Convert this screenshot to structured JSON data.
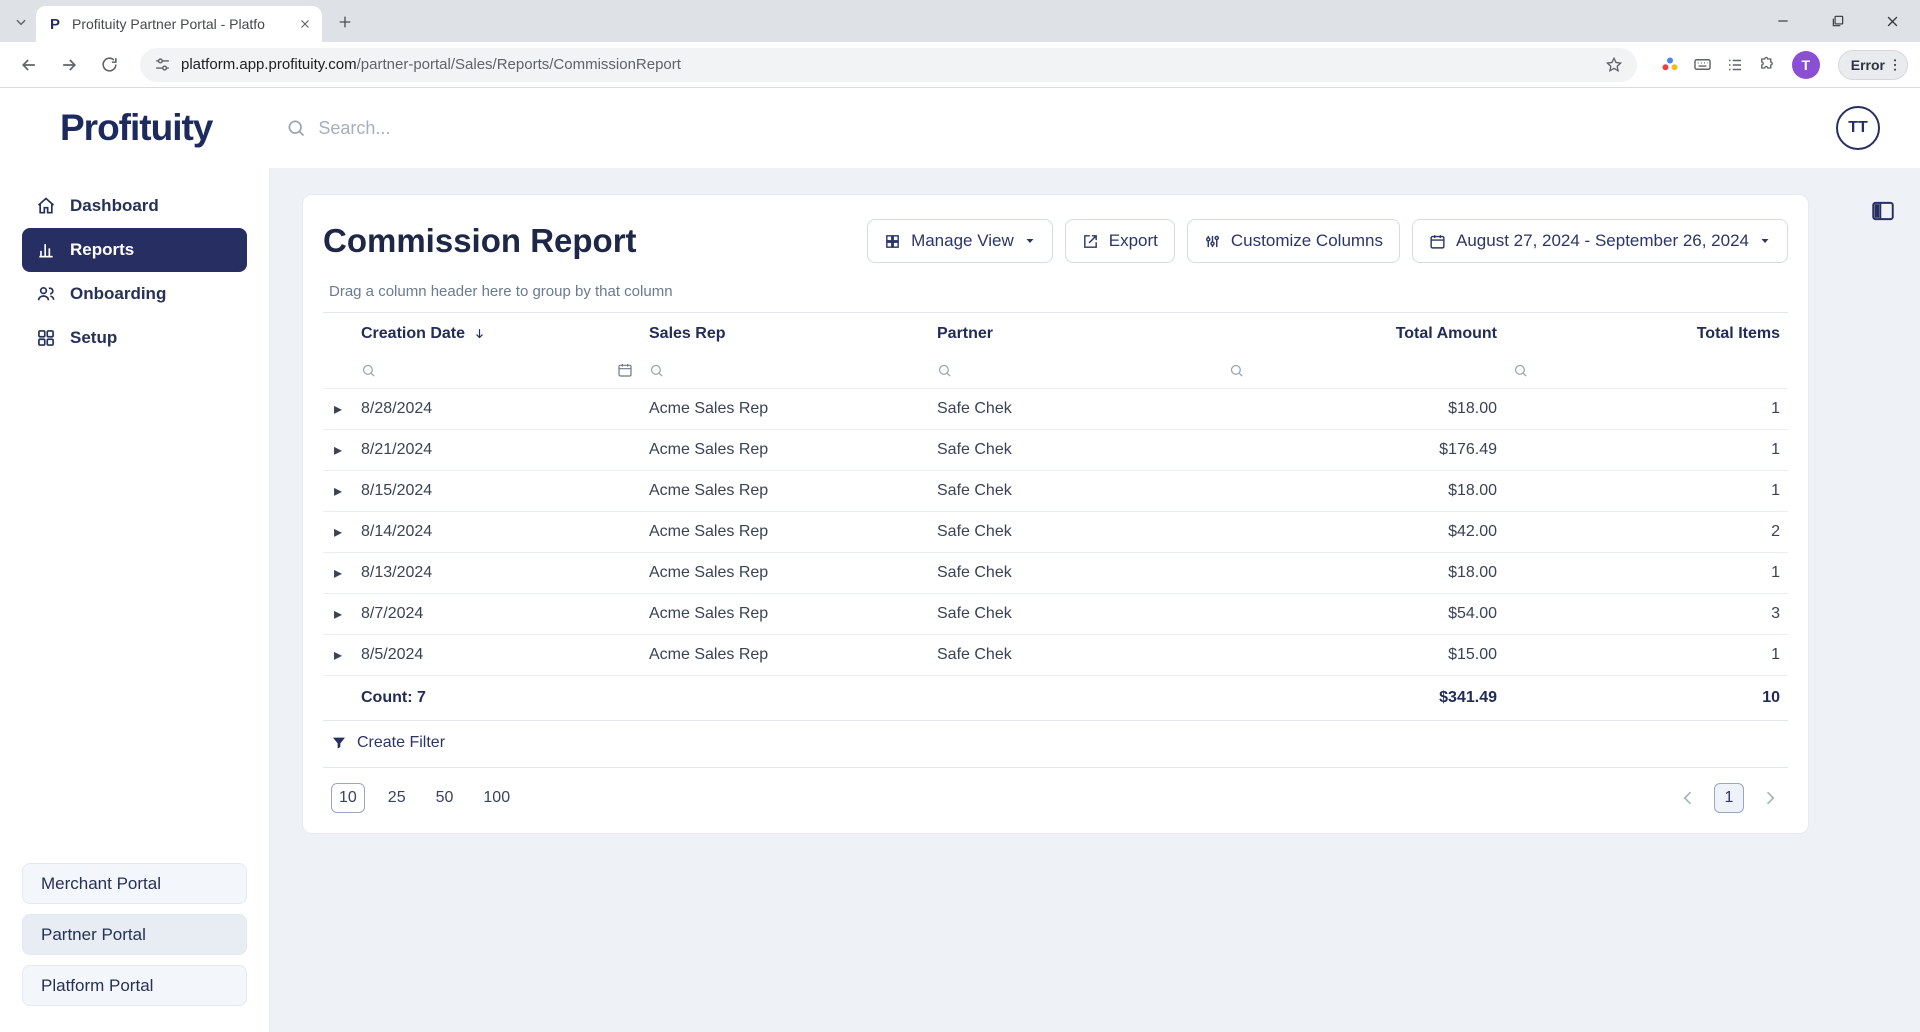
{
  "browser": {
    "tab": {
      "title": "Profituity Partner Portal - Platfo",
      "favicon_letter": "P"
    },
    "url": {
      "domain": "platform.app.profituity.com",
      "path": "/partner-portal/Sales/Reports/CommissionReport"
    },
    "error_label": "Error",
    "profile_initial": "T"
  },
  "app_header": {
    "logo": "Profituity",
    "search_placeholder": "Search...",
    "avatar_initials": "TT"
  },
  "sidebar": {
    "items": [
      {
        "label": "Dashboard",
        "icon": "home-icon"
      },
      {
        "label": "Reports",
        "icon": "bar-chart-icon"
      },
      {
        "label": "Onboarding",
        "icon": "users-icon"
      },
      {
        "label": "Setup",
        "icon": "widgets-icon"
      }
    ],
    "portal_buttons": [
      {
        "label": "Merchant Portal"
      },
      {
        "label": "Partner Portal"
      },
      {
        "label": "Platform Portal"
      }
    ]
  },
  "main": {
    "title": "Commission Report",
    "toolbar": {
      "manage_view_label": "Manage View",
      "export_label": "Export",
      "customize_columns_label": "Customize Columns",
      "date_range_label": "August 27, 2024 - September 26, 2024"
    },
    "group_hint": "Drag a column header here to group by that column",
    "table": {
      "columns": [
        "Creation Date",
        "Sales Rep",
        "Partner",
        "Total Amount",
        "Total Items"
      ],
      "rows": [
        {
          "creation_date": "8/28/2024",
          "sales_rep": "Acme Sales Rep",
          "partner": "Safe Chek",
          "total_amount": "$18.00",
          "total_items": "1"
        },
        {
          "creation_date": "8/21/2024",
          "sales_rep": "Acme Sales Rep",
          "partner": "Safe Chek",
          "total_amount": "$176.49",
          "total_items": "1"
        },
        {
          "creation_date": "8/15/2024",
          "sales_rep": "Acme Sales Rep",
          "partner": "Safe Chek",
          "total_amount": "$18.00",
          "total_items": "1"
        },
        {
          "creation_date": "8/14/2024",
          "sales_rep": "Acme Sales Rep",
          "partner": "Safe Chek",
          "total_amount": "$42.00",
          "total_items": "2"
        },
        {
          "creation_date": "8/13/2024",
          "sales_rep": "Acme Sales Rep",
          "partner": "Safe Chek",
          "total_amount": "$18.00",
          "total_items": "1"
        },
        {
          "creation_date": "8/7/2024",
          "sales_rep": "Acme Sales Rep",
          "partner": "Safe Chek",
          "total_amount": "$54.00",
          "total_items": "3"
        },
        {
          "creation_date": "8/5/2024",
          "sales_rep": "Acme Sales Rep",
          "partner": "Safe Chek",
          "total_amount": "$15.00",
          "total_items": "1"
        }
      ],
      "summary": {
        "count": "Count: 7",
        "total_amount": "$341.49",
        "total_items": "10"
      }
    },
    "create_filter_label": "Create Filter",
    "pagination": {
      "page_sizes": [
        "10",
        "25",
        "50",
        "100"
      ],
      "selected_page_size": "10",
      "current_page": "1"
    }
  },
  "theme": {
    "navy": "#272f62",
    "content_bg": "#eef1f6",
    "border": "#e1e7ee",
    "chrome_bg": "#dee1e6"
  }
}
